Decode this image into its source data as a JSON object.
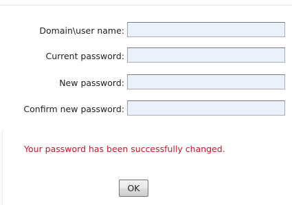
{
  "form": {
    "fields": [
      {
        "label": "Domain\\user name:",
        "value": ""
      },
      {
        "label": "Current password:",
        "value": ""
      },
      {
        "label": "New password:",
        "value": ""
      },
      {
        "label": "Confirm new password:",
        "value": ""
      }
    ]
  },
  "status": {
    "message": "Your password has been successfully changed.",
    "color": "#c8152a"
  },
  "actions": {
    "ok_label": "OK"
  }
}
